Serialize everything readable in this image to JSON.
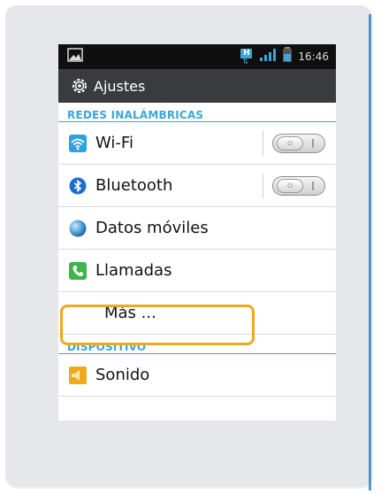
{
  "status_bar": {
    "time": "16:46",
    "network_badge": "H",
    "icons": [
      "image-icon",
      "hsdpa-icon",
      "signal-icon",
      "battery-icon"
    ]
  },
  "app_bar": {
    "title": "Ajustes",
    "icon": "gear-icon"
  },
  "sections": [
    {
      "header": "REDES INALÁMBRICAS",
      "items": [
        {
          "label": "Wi-Fi",
          "icon": "wifi-icon",
          "has_toggle": true,
          "toggle_state": "off"
        },
        {
          "label": "Bluetooth",
          "icon": "bluetooth-icon",
          "has_toggle": true,
          "toggle_state": "off"
        },
        {
          "label": "Datos móviles",
          "icon": "globe-icon",
          "has_toggle": false
        },
        {
          "label": "Llamadas",
          "icon": "phone-icon",
          "has_toggle": false
        },
        {
          "label": "Más ...",
          "icon": "",
          "has_toggle": false,
          "highlighted": true
        }
      ]
    },
    {
      "header": "DISPOSITIVO",
      "items": [
        {
          "label": "Sonido",
          "icon": "speaker-icon",
          "has_toggle": false
        }
      ]
    }
  ],
  "colors": {
    "accent": "#3aa7d6",
    "highlight": "#f0a81c",
    "status_bar_bg": "#0f0f10",
    "app_bar_bg": "#3a3b3f",
    "card_bg": "#e6e7ea"
  }
}
